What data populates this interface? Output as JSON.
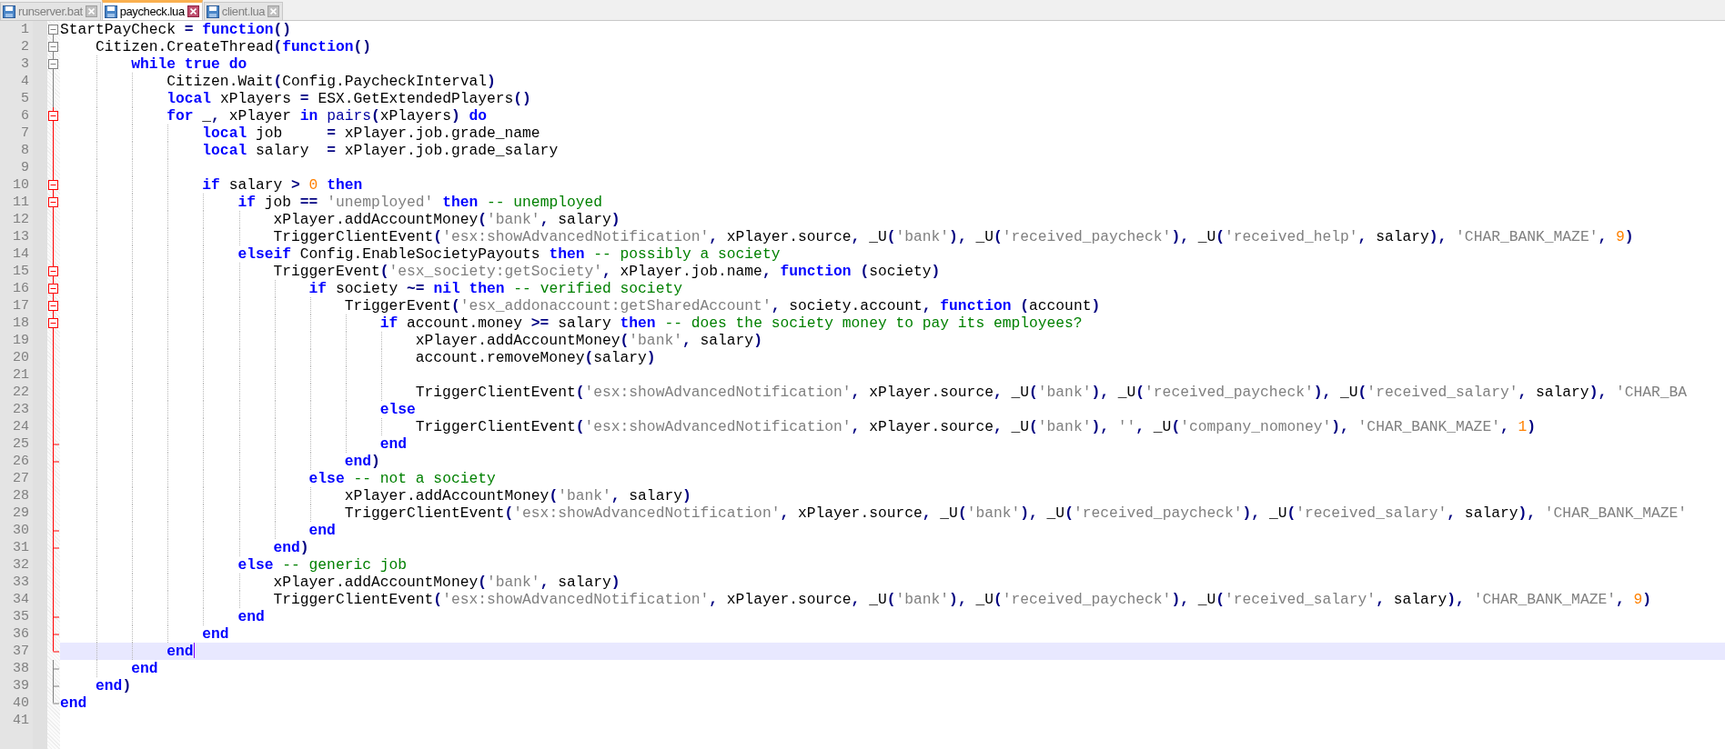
{
  "tabs": [
    {
      "label": "runserver.bat",
      "selected": false
    },
    {
      "label": "paycheck.lua",
      "selected": true
    },
    {
      "label": "client.lua",
      "selected": false
    }
  ],
  "lines": [
    {
      "number": "1",
      "fold_open": true,
      "fold_close": false,
      "active": false,
      "current": false,
      "tokens": [
        {
          "kind": "text",
          "text": "StartPayCheck "
        },
        {
          "kind": "op",
          "text": "="
        },
        {
          "kind": "keyword",
          "text": " function"
        },
        {
          "kind": "op",
          "text": "()"
        }
      ]
    },
    {
      "number": "2",
      "fold_open": true,
      "fold_close": false,
      "active": false,
      "current": false,
      "tokens": [
        {
          "kind": "text",
          "text": "    Citizen.CreateThread"
        },
        {
          "kind": "op",
          "text": "("
        },
        {
          "kind": "keyword",
          "text": "function"
        },
        {
          "kind": "op",
          "text": "()"
        }
      ]
    },
    {
      "number": "3",
      "fold_open": true,
      "fold_close": false,
      "active": false,
      "current": false,
      "tokens": [
        {
          "kind": "keyword",
          "text": "        while true do"
        }
      ]
    },
    {
      "number": "4",
      "fold_open": false,
      "fold_close": false,
      "active": false,
      "current": false,
      "tokens": [
        {
          "kind": "text",
          "text": "            Citizen.Wait"
        },
        {
          "kind": "op",
          "text": "("
        },
        {
          "kind": "text",
          "text": "Config.PaycheckInterval"
        },
        {
          "kind": "op",
          "text": ")"
        }
      ]
    },
    {
      "number": "5",
      "fold_open": false,
      "fold_close": false,
      "active": false,
      "current": false,
      "tokens": [
        {
          "kind": "keyword",
          "text": "            local"
        },
        {
          "kind": "text",
          "text": " xPlayers "
        },
        {
          "kind": "op",
          "text": "="
        },
        {
          "kind": "text",
          "text": " ESX.GetExtendedPlayers"
        },
        {
          "kind": "op",
          "text": "()"
        }
      ]
    },
    {
      "number": "6",
      "fold_open": true,
      "fold_close": false,
      "active": true,
      "current": false,
      "tokens": [
        {
          "kind": "keyword",
          "text": "            for"
        },
        {
          "kind": "text",
          "text": " _"
        },
        {
          "kind": "op",
          "text": ","
        },
        {
          "kind": "text",
          "text": " xPlayer "
        },
        {
          "kind": "keyword",
          "text": "in"
        },
        {
          "kind": "builtin",
          "text": " pairs"
        },
        {
          "kind": "op",
          "text": "("
        },
        {
          "kind": "text",
          "text": "xPlayers"
        },
        {
          "kind": "op",
          "text": ")"
        },
        {
          "kind": "keyword",
          "text": " do"
        }
      ]
    },
    {
      "number": "7",
      "fold_open": false,
      "fold_close": false,
      "active": true,
      "current": false,
      "tokens": [
        {
          "kind": "keyword",
          "text": "                local"
        },
        {
          "kind": "text",
          "text": " job     "
        },
        {
          "kind": "op",
          "text": "="
        },
        {
          "kind": "text",
          "text": " xPlayer.job.grade_name"
        }
      ]
    },
    {
      "number": "8",
      "fold_open": false,
      "fold_close": false,
      "active": true,
      "current": false,
      "tokens": [
        {
          "kind": "keyword",
          "text": "                local"
        },
        {
          "kind": "text",
          "text": " salary  "
        },
        {
          "kind": "op",
          "text": "="
        },
        {
          "kind": "text",
          "text": " xPlayer.job.grade_salary"
        }
      ]
    },
    {
      "number": "9",
      "fold_open": false,
      "fold_close": false,
      "active": true,
      "current": false
    },
    {
      "number": "10",
      "fold_open": true,
      "fold_close": false,
      "active": true,
      "current": false,
      "tokens": [
        {
          "kind": "keyword",
          "text": "                if"
        },
        {
          "kind": "text",
          "text": " salary "
        },
        {
          "kind": "op",
          "text": ">"
        },
        {
          "kind": "number",
          "text": " 0"
        },
        {
          "kind": "keyword",
          "text": " then"
        }
      ]
    },
    {
      "number": "11",
      "fold_open": true,
      "fold_close": false,
      "active": true,
      "current": false,
      "tokens": [
        {
          "kind": "keyword",
          "text": "                    if"
        },
        {
          "kind": "text",
          "text": " job "
        },
        {
          "kind": "op",
          "text": "=="
        },
        {
          "kind": "string",
          "text": " 'unemployed'"
        },
        {
          "kind": "keyword",
          "text": " then"
        },
        {
          "kind": "comment",
          "text": " -- unemployed"
        }
      ]
    },
    {
      "number": "12",
      "fold_open": false,
      "fold_close": false,
      "active": true,
      "current": false,
      "tokens": [
        {
          "kind": "text",
          "text": "                        xPlayer.addAccountMoney"
        },
        {
          "kind": "op",
          "text": "("
        },
        {
          "kind": "string",
          "text": "'bank'"
        },
        {
          "kind": "op",
          "text": ","
        },
        {
          "kind": "text",
          "text": " salary"
        },
        {
          "kind": "op",
          "text": ")"
        }
      ]
    },
    {
      "number": "13",
      "fold_open": false,
      "fold_close": false,
      "active": true,
      "current": false,
      "tokens": [
        {
          "kind": "text",
          "text": "                        TriggerClientEvent"
        },
        {
          "kind": "op",
          "text": "("
        },
        {
          "kind": "string",
          "text": "'esx:showAdvancedNotification'"
        },
        {
          "kind": "op",
          "text": ","
        },
        {
          "kind": "text",
          "text": " xPlayer.source"
        },
        {
          "kind": "op",
          "text": ","
        },
        {
          "kind": "text",
          "text": " _U"
        },
        {
          "kind": "op",
          "text": "("
        },
        {
          "kind": "string",
          "text": "'bank'"
        },
        {
          "kind": "op",
          "text": "),"
        },
        {
          "kind": "text",
          "text": " _U"
        },
        {
          "kind": "op",
          "text": "("
        },
        {
          "kind": "string",
          "text": "'received_paycheck'"
        },
        {
          "kind": "op",
          "text": "),"
        },
        {
          "kind": "text",
          "text": " _U"
        },
        {
          "kind": "op",
          "text": "("
        },
        {
          "kind": "string",
          "text": "'received_help'"
        },
        {
          "kind": "op",
          "text": ","
        },
        {
          "kind": "text",
          "text": " salary"
        },
        {
          "kind": "op",
          "text": "),"
        },
        {
          "kind": "string",
          "text": " 'CHAR_BANK_MAZE'"
        },
        {
          "kind": "op",
          "text": ","
        },
        {
          "kind": "number",
          "text": " 9"
        },
        {
          "kind": "op",
          "text": ")"
        }
      ]
    },
    {
      "number": "14",
      "fold_open": false,
      "fold_close": false,
      "active": true,
      "current": false,
      "tokens": [
        {
          "kind": "keyword",
          "text": "                    elseif"
        },
        {
          "kind": "text",
          "text": " Config.EnableSocietyPayouts "
        },
        {
          "kind": "keyword",
          "text": "then"
        },
        {
          "kind": "comment",
          "text": " -- possibly a society"
        }
      ]
    },
    {
      "number": "15",
      "fold_open": true,
      "fold_close": false,
      "active": true,
      "current": false,
      "tokens": [
        {
          "kind": "text",
          "text": "                        TriggerEvent"
        },
        {
          "kind": "op",
          "text": "("
        },
        {
          "kind": "string",
          "text": "'esx_society:getSociety'"
        },
        {
          "kind": "op",
          "text": ","
        },
        {
          "kind": "text",
          "text": " xPlayer.job.name"
        },
        {
          "kind": "op",
          "text": ","
        },
        {
          "kind": "keyword",
          "text": " function"
        },
        {
          "kind": "op",
          "text": " ("
        },
        {
          "kind": "text",
          "text": "society"
        },
        {
          "kind": "op",
          "text": ")"
        }
      ]
    },
    {
      "number": "16",
      "fold_open": true,
      "fold_close": false,
      "active": true,
      "current": false,
      "tokens": [
        {
          "kind": "keyword",
          "text": "                            if"
        },
        {
          "kind": "text",
          "text": " society "
        },
        {
          "kind": "op",
          "text": "~="
        },
        {
          "kind": "keyword",
          "text": " nil then"
        },
        {
          "kind": "comment",
          "text": " -- verified society"
        }
      ]
    },
    {
      "number": "17",
      "fold_open": true,
      "fold_close": false,
      "active": true,
      "current": false,
      "tokens": [
        {
          "kind": "text",
          "text": "                                TriggerEvent"
        },
        {
          "kind": "op",
          "text": "("
        },
        {
          "kind": "string",
          "text": "'esx_addonaccount:getSharedAccount'"
        },
        {
          "kind": "op",
          "text": ","
        },
        {
          "kind": "text",
          "text": " society.account"
        },
        {
          "kind": "op",
          "text": ","
        },
        {
          "kind": "keyword",
          "text": " function"
        },
        {
          "kind": "op",
          "text": " ("
        },
        {
          "kind": "text",
          "text": "account"
        },
        {
          "kind": "op",
          "text": ")"
        }
      ]
    },
    {
      "number": "18",
      "fold_open": true,
      "fold_close": false,
      "active": true,
      "current": false,
      "tokens": [
        {
          "kind": "keyword",
          "text": "                                    if"
        },
        {
          "kind": "text",
          "text": " account.money "
        },
        {
          "kind": "op",
          "text": ">="
        },
        {
          "kind": "text",
          "text": " salary "
        },
        {
          "kind": "keyword",
          "text": "then"
        },
        {
          "kind": "comment",
          "text": " -- does the society money to pay its employees?"
        }
      ]
    },
    {
      "number": "19",
      "fold_open": false,
      "fold_close": false,
      "active": true,
      "current": false,
      "tokens": [
        {
          "kind": "text",
          "text": "                                        xPlayer.addAccountMoney"
        },
        {
          "kind": "op",
          "text": "("
        },
        {
          "kind": "string",
          "text": "'bank'"
        },
        {
          "kind": "op",
          "text": ","
        },
        {
          "kind": "text",
          "text": " salary"
        },
        {
          "kind": "op",
          "text": ")"
        }
      ]
    },
    {
      "number": "20",
      "fold_open": false,
      "fold_close": false,
      "active": true,
      "current": false,
      "tokens": [
        {
          "kind": "text",
          "text": "                                        account.removeMoney"
        },
        {
          "kind": "op",
          "text": "("
        },
        {
          "kind": "text",
          "text": "salary"
        },
        {
          "kind": "op",
          "text": ")"
        }
      ]
    },
    {
      "number": "21",
      "fold_open": false,
      "fold_close": false,
      "active": true,
      "current": false
    },
    {
      "number": "22",
      "fold_open": false,
      "fold_close": false,
      "active": true,
      "current": false,
      "tokens": [
        {
          "kind": "text",
          "text": "                                        TriggerClientEvent"
        },
        {
          "kind": "op",
          "text": "("
        },
        {
          "kind": "string",
          "text": "'esx:showAdvancedNotification'"
        },
        {
          "kind": "op",
          "text": ","
        },
        {
          "kind": "text",
          "text": " xPlayer.source"
        },
        {
          "kind": "op",
          "text": ","
        },
        {
          "kind": "text",
          "text": " _U"
        },
        {
          "kind": "op",
          "text": "("
        },
        {
          "kind": "string",
          "text": "'bank'"
        },
        {
          "kind": "op",
          "text": "),"
        },
        {
          "kind": "text",
          "text": " _U"
        },
        {
          "kind": "op",
          "text": "("
        },
        {
          "kind": "string",
          "text": "'received_paycheck'"
        },
        {
          "kind": "op",
          "text": "),"
        },
        {
          "kind": "text",
          "text": " _U"
        },
        {
          "kind": "op",
          "text": "("
        },
        {
          "kind": "string",
          "text": "'received_salary'"
        },
        {
          "kind": "op",
          "text": ","
        },
        {
          "kind": "text",
          "text": " salary"
        },
        {
          "kind": "op",
          "text": "),"
        },
        {
          "kind": "string",
          "text": " 'CHAR_BA"
        }
      ]
    },
    {
      "number": "23",
      "fold_open": false,
      "fold_close": false,
      "active": true,
      "current": false,
      "tokens": [
        {
          "kind": "keyword",
          "text": "                                    else"
        }
      ]
    },
    {
      "number": "24",
      "fold_open": false,
      "fold_close": false,
      "active": true,
      "current": false,
      "tokens": [
        {
          "kind": "text",
          "text": "                                        TriggerClientEvent"
        },
        {
          "kind": "op",
          "text": "("
        },
        {
          "kind": "string",
          "text": "'esx:showAdvancedNotification'"
        },
        {
          "kind": "op",
          "text": ","
        },
        {
          "kind": "text",
          "text": " xPlayer.source"
        },
        {
          "kind": "op",
          "text": ","
        },
        {
          "kind": "text",
          "text": " _U"
        },
        {
          "kind": "op",
          "text": "("
        },
        {
          "kind": "string",
          "text": "'bank'"
        },
        {
          "kind": "op",
          "text": "),"
        },
        {
          "kind": "string",
          "text": " ''"
        },
        {
          "kind": "op",
          "text": ","
        },
        {
          "kind": "text",
          "text": " _U"
        },
        {
          "kind": "op",
          "text": "("
        },
        {
          "kind": "string",
          "text": "'company_nomoney'"
        },
        {
          "kind": "op",
          "text": "),"
        },
        {
          "kind": "string",
          "text": " 'CHAR_BANK_MAZE'"
        },
        {
          "kind": "op",
          "text": ","
        },
        {
          "kind": "number",
          "text": " 1"
        },
        {
          "kind": "op",
          "text": ")"
        }
      ]
    },
    {
      "number": "25",
      "fold_open": false,
      "fold_close": true,
      "active": true,
      "current": false,
      "tokens": [
        {
          "kind": "keyword",
          "text": "                                    end"
        }
      ]
    },
    {
      "number": "26",
      "fold_open": false,
      "fold_close": true,
      "active": true,
      "current": false,
      "tokens": [
        {
          "kind": "keyword",
          "text": "                                end"
        },
        {
          "kind": "op",
          "text": ")"
        }
      ]
    },
    {
      "number": "27",
      "fold_open": false,
      "fold_close": false,
      "active": true,
      "current": false,
      "tokens": [
        {
          "kind": "keyword",
          "text": "                            else"
        },
        {
          "kind": "comment",
          "text": " -- not a society"
        }
      ]
    },
    {
      "number": "28",
      "fold_open": false,
      "fold_close": false,
      "active": true,
      "current": false,
      "tokens": [
        {
          "kind": "text",
          "text": "                                xPlayer.addAccountMoney"
        },
        {
          "kind": "op",
          "text": "("
        },
        {
          "kind": "string",
          "text": "'bank'"
        },
        {
          "kind": "op",
          "text": ","
        },
        {
          "kind": "text",
          "text": " salary"
        },
        {
          "kind": "op",
          "text": ")"
        }
      ]
    },
    {
      "number": "29",
      "fold_open": false,
      "fold_close": false,
      "active": true,
      "current": false,
      "tokens": [
        {
          "kind": "text",
          "text": "                                TriggerClientEvent"
        },
        {
          "kind": "op",
          "text": "("
        },
        {
          "kind": "string",
          "text": "'esx:showAdvancedNotification'"
        },
        {
          "kind": "op",
          "text": ","
        },
        {
          "kind": "text",
          "text": " xPlayer.source"
        },
        {
          "kind": "op",
          "text": ","
        },
        {
          "kind": "text",
          "text": " _U"
        },
        {
          "kind": "op",
          "text": "("
        },
        {
          "kind": "string",
          "text": "'bank'"
        },
        {
          "kind": "op",
          "text": "),"
        },
        {
          "kind": "text",
          "text": " _U"
        },
        {
          "kind": "op",
          "text": "("
        },
        {
          "kind": "string",
          "text": "'received_paycheck'"
        },
        {
          "kind": "op",
          "text": "),"
        },
        {
          "kind": "text",
          "text": " _U"
        },
        {
          "kind": "op",
          "text": "("
        },
        {
          "kind": "string",
          "text": "'received_salary'"
        },
        {
          "kind": "op",
          "text": ","
        },
        {
          "kind": "text",
          "text": " salary"
        },
        {
          "kind": "op",
          "text": "),"
        },
        {
          "kind": "string",
          "text": " 'CHAR_BANK_MAZE'"
        }
      ]
    },
    {
      "number": "30",
      "fold_open": false,
      "fold_close": true,
      "active": true,
      "current": false,
      "tokens": [
        {
          "kind": "keyword",
          "text": "                            end"
        }
      ]
    },
    {
      "number": "31",
      "fold_open": false,
      "fold_close": true,
      "active": true,
      "current": false,
      "tokens": [
        {
          "kind": "keyword",
          "text": "                        end"
        },
        {
          "kind": "op",
          "text": ")"
        }
      ]
    },
    {
      "number": "32",
      "fold_open": false,
      "fold_close": false,
      "active": true,
      "current": false,
      "tokens": [
        {
          "kind": "keyword",
          "text": "                    else"
        },
        {
          "kind": "comment",
          "text": " -- generic job"
        }
      ]
    },
    {
      "number": "33",
      "fold_open": false,
      "fold_close": false,
      "active": true,
      "current": false,
      "tokens": [
        {
          "kind": "text",
          "text": "                        xPlayer.addAccountMoney"
        },
        {
          "kind": "op",
          "text": "("
        },
        {
          "kind": "string",
          "text": "'bank'"
        },
        {
          "kind": "op",
          "text": ","
        },
        {
          "kind": "text",
          "text": " salary"
        },
        {
          "kind": "op",
          "text": ")"
        }
      ]
    },
    {
      "number": "34",
      "fold_open": false,
      "fold_close": false,
      "active": true,
      "current": false,
      "tokens": [
        {
          "kind": "text",
          "text": "                        TriggerClientEvent"
        },
        {
          "kind": "op",
          "text": "("
        },
        {
          "kind": "string",
          "text": "'esx:showAdvancedNotification'"
        },
        {
          "kind": "op",
          "text": ","
        },
        {
          "kind": "text",
          "text": " xPlayer.source"
        },
        {
          "kind": "op",
          "text": ","
        },
        {
          "kind": "text",
          "text": " _U"
        },
        {
          "kind": "op",
          "text": "("
        },
        {
          "kind": "string",
          "text": "'bank'"
        },
        {
          "kind": "op",
          "text": "),"
        },
        {
          "kind": "text",
          "text": " _U"
        },
        {
          "kind": "op",
          "text": "("
        },
        {
          "kind": "string",
          "text": "'received_paycheck'"
        },
        {
          "kind": "op",
          "text": "),"
        },
        {
          "kind": "text",
          "text": " _U"
        },
        {
          "kind": "op",
          "text": "("
        },
        {
          "kind": "string",
          "text": "'received_salary'"
        },
        {
          "kind": "op",
          "text": ","
        },
        {
          "kind": "text",
          "text": " salary"
        },
        {
          "kind": "op",
          "text": "),"
        },
        {
          "kind": "string",
          "text": " 'CHAR_BANK_MAZE'"
        },
        {
          "kind": "op",
          "text": ","
        },
        {
          "kind": "number",
          "text": " 9"
        },
        {
          "kind": "op",
          "text": ")"
        }
      ]
    },
    {
      "number": "35",
      "fold_open": false,
      "fold_close": true,
      "active": true,
      "current": false,
      "tokens": [
        {
          "kind": "keyword",
          "text": "                    end"
        }
      ]
    },
    {
      "number": "36",
      "fold_open": false,
      "fold_close": true,
      "active": true,
      "current": false,
      "tokens": [
        {
          "kind": "keyword",
          "text": "                end"
        }
      ]
    },
    {
      "number": "37",
      "fold_open": false,
      "fold_close": true,
      "active": true,
      "current": true,
      "tokens": [
        {
          "kind": "keyword",
          "text": "            end"
        }
      ]
    },
    {
      "number": "38",
      "fold_open": false,
      "fold_close": true,
      "active": false,
      "current": false,
      "tokens": [
        {
          "kind": "keyword",
          "text": "        end"
        }
      ]
    },
    {
      "number": "39",
      "fold_open": false,
      "fold_close": true,
      "active": false,
      "current": false,
      "tokens": [
        {
          "kind": "keyword",
          "text": "    end"
        },
        {
          "kind": "op",
          "text": ")"
        }
      ]
    },
    {
      "number": "40",
      "fold_open": false,
      "fold_close": true,
      "active": false,
      "current": false,
      "tokens": [
        {
          "kind": "keyword",
          "text": "end"
        }
      ]
    },
    {
      "number": "41",
      "current": false
    }
  ]
}
